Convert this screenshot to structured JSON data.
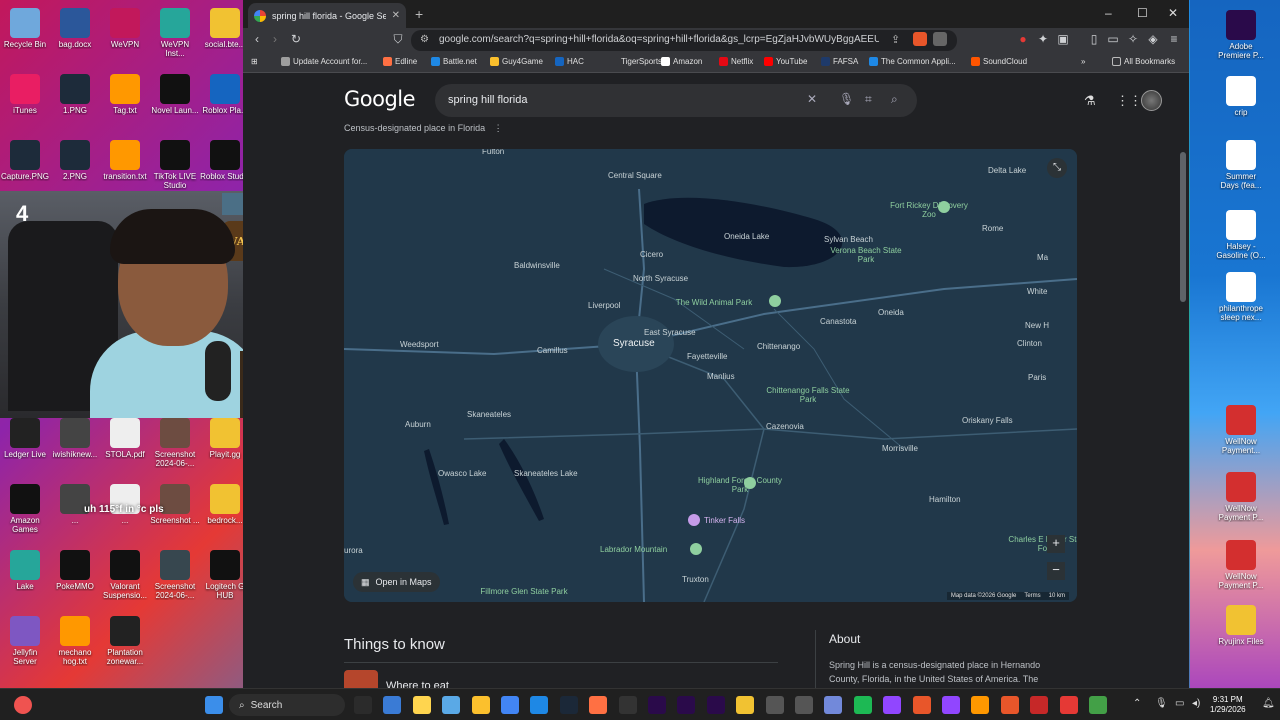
{
  "desktop": {
    "left_icons": [
      {
        "label": "Recycle Bin",
        "color": "#6fa8dc"
      },
      {
        "label": "bag.docx",
        "color": "#2b579a"
      },
      {
        "label": "WeVPN",
        "color": "#c2185b"
      },
      {
        "label": "WeVPN Inst...",
        "color": "#26a69a"
      },
      {
        "label": "social.bte...",
        "color": "#f1c232"
      },
      {
        "label": "iTunes",
        "color": "#e91e63"
      },
      {
        "label": "1.PNG",
        "color": "#1d2b3a"
      },
      {
        "label": "Tag.txt",
        "color": "#ff9800"
      },
      {
        "label": "Novel Laun...",
        "color": "#111111"
      },
      {
        "label": "Roblox Pla...",
        "color": "#1565c0"
      },
      {
        "label": "Capture.PNG",
        "color": "#1d2b3a"
      },
      {
        "label": "2.PNG",
        "color": "#1d2b3a"
      },
      {
        "label": "transition.txt",
        "color": "#ff9800"
      },
      {
        "label": "TikTok LIVE Studio",
        "color": "#111111"
      },
      {
        "label": "Roblox Studio",
        "color": "#111111"
      }
    ],
    "lower_icons": [
      {
        "label": "Ledger Live",
        "color": "#222222"
      },
      {
        "label": "iwishiknew...",
        "color": "#444444"
      },
      {
        "label": "STOLA.pdf",
        "color": "#eeeeee"
      },
      {
        "label": "Screenshot 2024-06-...",
        "color": "#6d4c41"
      },
      {
        "label": "Playit.gg",
        "color": "#f1c232"
      },
      {
        "label": "Amazon Games",
        "color": "#111111"
      },
      {
        "label": "...",
        "color": "#444444"
      },
      {
        "label": "...",
        "color": "#eeeeee"
      },
      {
        "label": "Screenshot ...",
        "color": "#6d4c41"
      },
      {
        "label": "bedrock...",
        "color": "#f1c232"
      },
      {
        "label": "Lake",
        "color": "#26a69a"
      },
      {
        "label": "PokeMMO",
        "color": "#111111"
      },
      {
        "label": "Valorant Suspensio...",
        "color": "#111111"
      },
      {
        "label": "Screenshot 2024-06-...",
        "color": "#37474f"
      },
      {
        "label": "Logitech G HUB",
        "color": "#111111"
      },
      {
        "label": "Jellyfin Server",
        "color": "#7e57c2"
      },
      {
        "label": "mechano hog.txt",
        "color": "#ff9800"
      },
      {
        "label": "Plantation zonewar...",
        "color": "#222222"
      }
    ],
    "overlay_text": "uh 115°f in °c pls",
    "right_icons": [
      {
        "label": "Adobe Premiere P...",
        "color": "#2a0a4a"
      },
      {
        "label": "crip",
        "color": "#ffffff"
      },
      {
        "label": "Summer Days (fea...",
        "color": "#ffffff"
      },
      {
        "label": "Halsey - Gasoline (O...",
        "color": "#ffffff"
      },
      {
        "label": "philanthrope sleep nex...",
        "color": "#ffffff"
      },
      {
        "label": "WellNow Payment...",
        "color": "#d32f2f"
      },
      {
        "label": "WellNow Payment P...",
        "color": "#d32f2f"
      },
      {
        "label": "WellNow Payment P...",
        "color": "#d32f2f"
      },
      {
        "label": "Ryujinx Files",
        "color": "#f1c232"
      }
    ],
    "webcam_number": "4",
    "webcam_sign": "WARCRAFT"
  },
  "browser": {
    "tab_title": "spring hill florida - Google Search",
    "url": "google.com/search?q=spring+hill+florida&oq=spring+hill+florida&gs_lcrp=EgZjaHJvbWUyBggAEEUYOTI...",
    "bookmarks": [
      {
        "label": "Update Account for...",
        "color": "#9e9e9e"
      },
      {
        "label": "Edline",
        "color": "#ff7043"
      },
      {
        "label": "Battle.net",
        "color": "#1e88e5"
      },
      {
        "label": "Guy4Game",
        "color": "#fbc02d"
      },
      {
        "label": "HAC",
        "color": "#1565c0"
      },
      {
        "label": "TigerSports",
        "color": "#35363a"
      },
      {
        "label": "Amazon",
        "color": "#ffffff"
      },
      {
        "label": "Netflix",
        "color": "#e50914"
      },
      {
        "label": "YouTube",
        "color": "#ff0000"
      },
      {
        "label": "FAFSA",
        "color": "#1e3a6a"
      },
      {
        "label": "The Common Appli...",
        "color": "#1e88e5"
      },
      {
        "label": "SoundCloud",
        "color": "#ff5500"
      }
    ],
    "all_bookmarks": "All Bookmarks"
  },
  "google": {
    "logo": "Google",
    "query": "spring hill florida",
    "subtitle": "Census-designated place in Florida",
    "open_in_maps": "Open in Maps",
    "attribution": [
      "Map data ©2026 Google",
      "Terms",
      "10 km"
    ],
    "things_to_know": "Things to know",
    "where_to_eat": "Where to eat",
    "about_heading": "About",
    "about_text": "Spring Hill is a census-designated place in Hernando County, Florida, in the United States of America. The"
  },
  "map_places": [
    {
      "name": "Fulton",
      "cls": ""
    },
    {
      "name": "Central Square",
      "cls": ""
    },
    {
      "name": "Delta Lake",
      "cls": ""
    },
    {
      "name": "Fort Rickey Discovery Zoo",
      "cls": "green"
    },
    {
      "name": "Rome",
      "cls": ""
    },
    {
      "name": "Oneida Lake",
      "cls": ""
    },
    {
      "name": "Sylvan Beach",
      "cls": ""
    },
    {
      "name": "Verona Beach State Park",
      "cls": "green"
    },
    {
      "name": "Cicero",
      "cls": ""
    },
    {
      "name": "Baldwinsville",
      "cls": ""
    },
    {
      "name": "North Syracuse",
      "cls": ""
    },
    {
      "name": "The Wild Animal Park",
      "cls": "green"
    },
    {
      "name": "Liverpool",
      "cls": ""
    },
    {
      "name": "Canastota",
      "cls": ""
    },
    {
      "name": "Oneida",
      "cls": ""
    },
    {
      "name": "White",
      "cls": ""
    },
    {
      "name": "New H",
      "cls": ""
    },
    {
      "name": "Ma",
      "cls": ""
    },
    {
      "name": "East Syracuse",
      "cls": ""
    },
    {
      "name": "Syracuse",
      "cls": "big"
    },
    {
      "name": "Weedsport",
      "cls": ""
    },
    {
      "name": "Camillus",
      "cls": ""
    },
    {
      "name": "Fayetteville",
      "cls": ""
    },
    {
      "name": "Chittenango",
      "cls": ""
    },
    {
      "name": "Clinton",
      "cls": ""
    },
    {
      "name": "Manlius",
      "cls": ""
    },
    {
      "name": "Paris",
      "cls": ""
    },
    {
      "name": "Chittenango Falls State Park",
      "cls": "green"
    },
    {
      "name": "Skaneateles",
      "cls": ""
    },
    {
      "name": "Auburn",
      "cls": ""
    },
    {
      "name": "Oriskany Falls",
      "cls": ""
    },
    {
      "name": "Cazenovia",
      "cls": ""
    },
    {
      "name": "Morrisville",
      "cls": ""
    },
    {
      "name": "Owasco Lake",
      "cls": ""
    },
    {
      "name": "Skaneateles Lake",
      "cls": ""
    },
    {
      "name": "Highland Forest County Park",
      "cls": "green"
    },
    {
      "name": "Hamilton",
      "cls": ""
    },
    {
      "name": "Tinker Falls",
      "cls": "purple"
    },
    {
      "name": "Charles E Baker State Fores",
      "cls": "green"
    },
    {
      "name": "urora",
      "cls": ""
    },
    {
      "name": "Labrador Mountain",
      "cls": "green"
    },
    {
      "name": "Truxton",
      "cls": ""
    },
    {
      "name": "Fillmore Glen State Park",
      "cls": "green"
    }
  ],
  "taskbar": {
    "search_label": "Search",
    "time": "9:31 PM",
    "date": "1/29/2026"
  }
}
